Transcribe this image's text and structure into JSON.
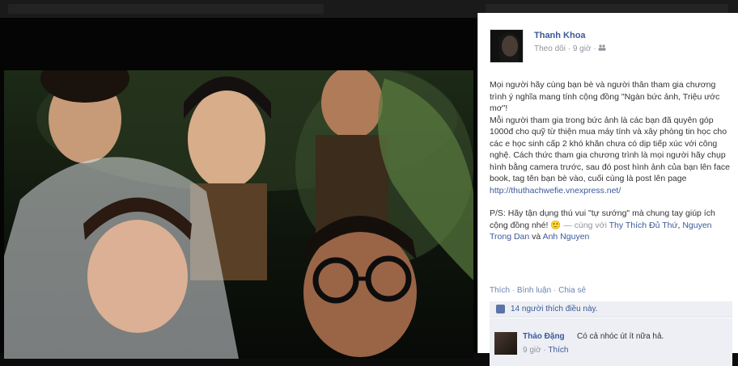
{
  "post": {
    "author": "Thanh Khoa",
    "follow_label": "Theo dõi",
    "dot": "·",
    "time": "9 giờ",
    "audience_icon": "friends-icon",
    "paragraphs": [
      "Mọi người hãy cùng bạn bè và người thân tham gia chương trình ý nghĩa mang tính cộng đồng \"Ngàn bức ảnh, Triệu ước mơ\"!",
      "Mỗi người tham gia trong bức ảnh là các bạn đã quyên góp 1000đ cho quỹ từ thiện mua máy tính và xây phòng tin học cho các e học sinh cấp 2 khó khăn chưa có dịp tiếp xúc với công nghệ. Cách thức tham gia chương trình là mọi người hãy chụp hình bằng camera trước, sau đó post hình ảnh của bạn lên face book, tag tên bạn bè vào, cuối cùng là post lên page",
      "P/S: Hãy tận dụng thú vui \"tự sướng\" mà chung tay giúp ích cộng đồng nhé!"
    ],
    "page_link": "http://thuthachwefie.vnexpress.net/",
    "with_label": "— cùng với",
    "tag1": "Thy Thích Đủ Thứ",
    "tag2": "Nguyen Trong Dan",
    "and_label": "và",
    "tag3": "Anh Nguyen",
    "smile": "🙂"
  },
  "actions": {
    "like": "Thích",
    "comment": "Bình luận",
    "share": "Chia sẻ",
    "sep": "·"
  },
  "likes": {
    "text": "14 người thích điều này."
  },
  "comment": {
    "name": "Thảo Đặng",
    "text": "Có cả nhóc út ít nữa hả.",
    "time": "9 giờ",
    "like": "Thích",
    "sep": "·"
  },
  "close_glyph": "×"
}
